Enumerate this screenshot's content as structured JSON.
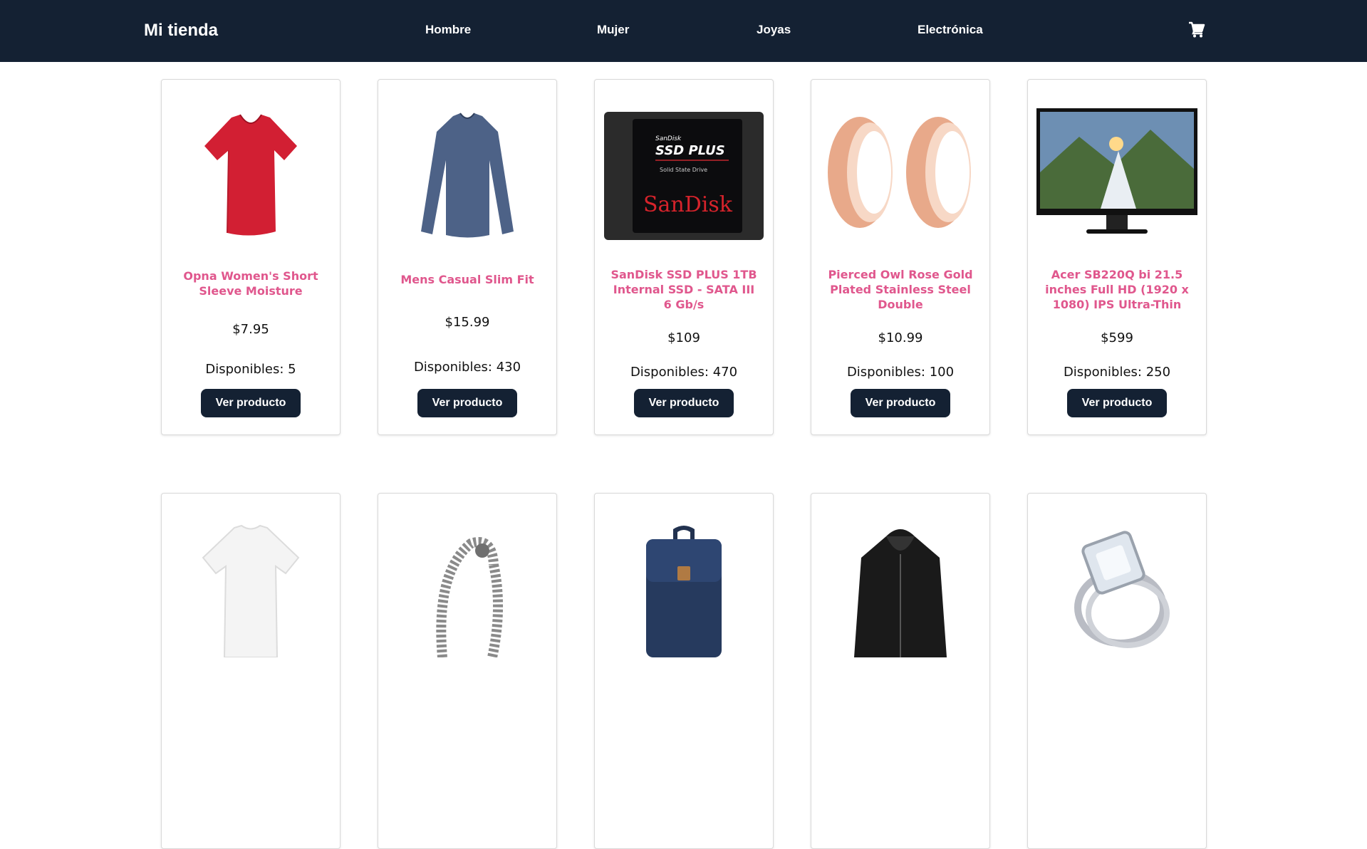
{
  "navbar": {
    "brand": "Mi tienda",
    "links": [
      "Hombre",
      "Mujer",
      "Joyas",
      "Electrónica"
    ],
    "cart_icon": "shopping-cart-icon"
  },
  "colors": {
    "navbar_bg": "#142133",
    "title_pink": "#e0578d",
    "button_bg": "#142133"
  },
  "products": [
    {
      "title": "Opna Women's Short Sleeve Moisture",
      "price": "$7.95",
      "stock": "Disponibles: 5",
      "button": "Ver producto",
      "image": "red-tshirt-image"
    },
    {
      "title": "Mens Casual Slim Fit",
      "price": "$15.99",
      "stock": "Disponibles: 430",
      "button": "Ver producto",
      "image": "blue-long-sleeve-shirt-image"
    },
    {
      "title": "SanDisk SSD PLUS 1TB Internal SSD - SATA III 6 Gb/s",
      "price": "$109",
      "stock": "Disponibles: 470",
      "button": "Ver producto",
      "image": "sandisk-ssd-image",
      "image_text": {
        "brand_small": "SanDisk",
        "model": "SSD PLUS",
        "sub": "Solid State Drive",
        "brand": "SanDisk"
      }
    },
    {
      "title": "Pierced Owl Rose Gold Plated Stainless Steel Double",
      "price": "$10.99",
      "stock": "Disponibles: 100",
      "button": "Ver producto",
      "image": "rose-gold-plugs-image"
    },
    {
      "title": "Acer SB220Q bi 21.5 inches Full HD (1920 x 1080) IPS Ultra-Thin",
      "price": "$599",
      "stock": "Disponibles: 250",
      "button": "Ver producto",
      "image": "acer-monitor-image"
    }
  ],
  "products_row2": [
    {
      "image": "white-tshirt-image"
    },
    {
      "image": "silver-bracelet-image"
    },
    {
      "image": "navy-backpack-image"
    },
    {
      "image": "black-leather-jacket-image"
    },
    {
      "image": "diamond-ring-image"
    }
  ]
}
